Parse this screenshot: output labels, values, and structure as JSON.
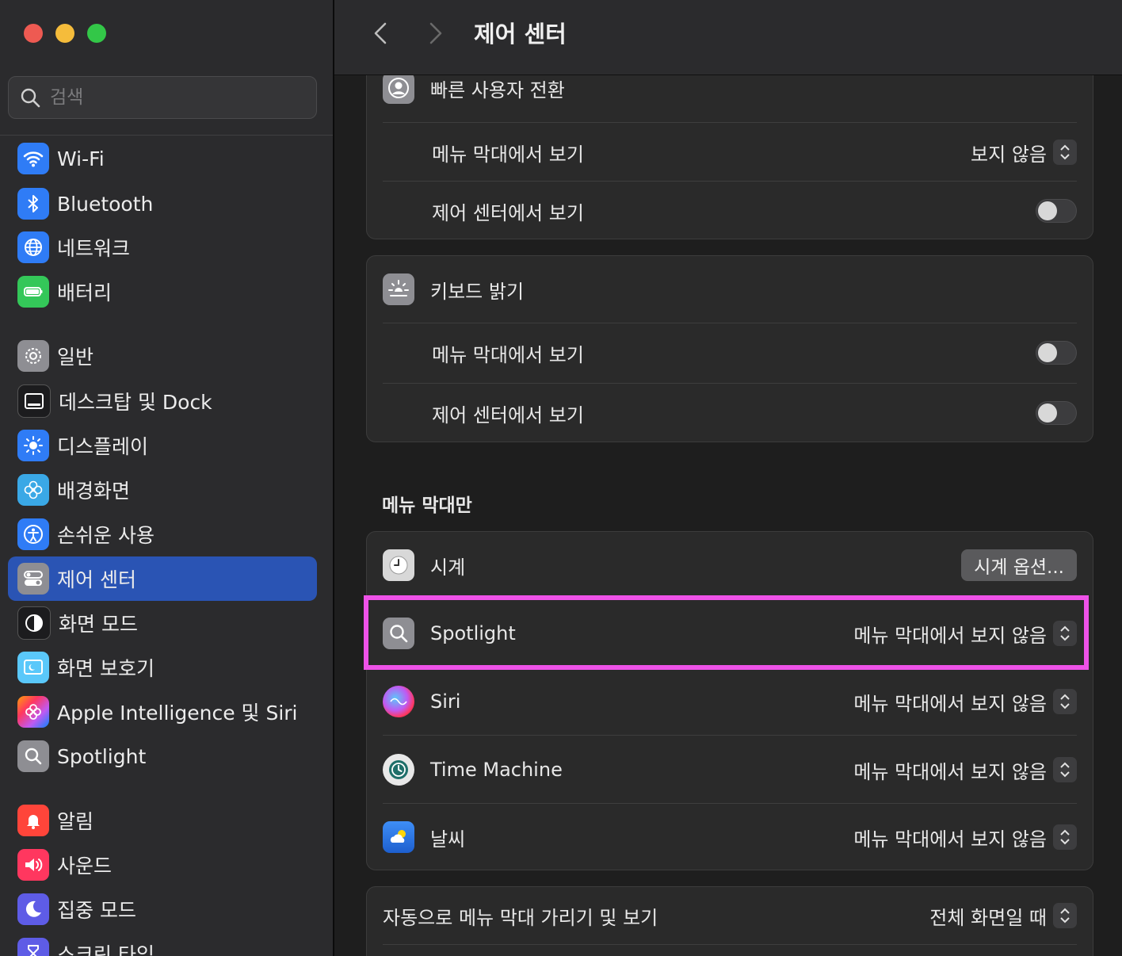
{
  "window": {
    "traffic_lights": [
      "close",
      "minimize",
      "zoom"
    ]
  },
  "sidebar": {
    "search_placeholder": "검색",
    "items": [
      {
        "label": "Wi-Fi",
        "icon": "wifi-icon",
        "color": "#2f7cf6"
      },
      {
        "label": "Bluetooth",
        "icon": "bluetooth-icon",
        "color": "#2f7cf6"
      },
      {
        "label": "네트워크",
        "icon": "globe-icon",
        "color": "#2f7cf6"
      },
      {
        "label": "배터리",
        "icon": "battery-icon",
        "color": "#34c759"
      },
      {
        "label": "일반",
        "icon": "gear-icon",
        "color": "#8e8e93"
      },
      {
        "label": "데스크탑 및 Dock",
        "icon": "dock-icon",
        "color": "#1c1c1e"
      },
      {
        "label": "디스플레이",
        "icon": "sun-icon",
        "color": "#2f7cf6"
      },
      {
        "label": "배경화면",
        "icon": "flower-icon",
        "color": "#3aa8e6"
      },
      {
        "label": "손쉬운 사용",
        "icon": "accessibility-icon",
        "color": "#2f7cf6"
      },
      {
        "label": "제어 센터",
        "icon": "control-center-icon",
        "color": "#8e8e93",
        "active": true
      },
      {
        "label": "화면 모드",
        "icon": "appearance-icon",
        "color": "#1c1c1e"
      },
      {
        "label": "화면 보호기",
        "icon": "screensaver-icon",
        "color": "#5ac8fa"
      },
      {
        "label": "Apple Intelligence 및 Siri",
        "icon": "apple-intelligence-icon",
        "color": "#ff6b8a"
      },
      {
        "label": "Spotlight",
        "icon": "spotlight-icon",
        "color": "#8e8e93"
      },
      {
        "label": "알림",
        "icon": "bell-icon",
        "color": "#ff453a"
      },
      {
        "label": "사운드",
        "icon": "speaker-icon",
        "color": "#ff375f"
      },
      {
        "label": "집중 모드",
        "icon": "moon-icon",
        "color": "#5e5ce6"
      },
      {
        "label": "스크린 타임",
        "icon": "hourglass-icon",
        "color": "#5e5ce6"
      }
    ]
  },
  "toolbar": {
    "title": "제어 센터"
  },
  "fast_user_switching": {
    "title": "빠른 사용자 전환",
    "menu_bar_label": "메뉴 막대에서 보기",
    "menu_bar_value": "보지 않음",
    "control_center_label": "제어 센터에서 보기"
  },
  "keyboard_brightness": {
    "title": "키보드 밝기",
    "menu_bar_label": "메뉴 막대에서 보기",
    "control_center_label": "제어 센터에서 보기"
  },
  "menu_bar_only": {
    "section_title": "메뉴 막대만",
    "clock": {
      "label": "시계",
      "button": "시계 옵션..."
    },
    "items": [
      {
        "label": "Spotlight",
        "value": "메뉴 막대에서 보지 않음"
      },
      {
        "label": "Siri",
        "value": "메뉴 막대에서 보지 않음"
      },
      {
        "label": "Time Machine",
        "value": "메뉴 막대에서 보지 않음"
      },
      {
        "label": "날씨",
        "value": "메뉴 막대에서 보지 않음"
      }
    ]
  },
  "autohide": {
    "label": "자동으로 메뉴 막대 가리기 및 보기",
    "value": "전체 화면일 때"
  },
  "colors": {
    "accent": "#2a54b4",
    "highlight": "#ee52e8"
  }
}
